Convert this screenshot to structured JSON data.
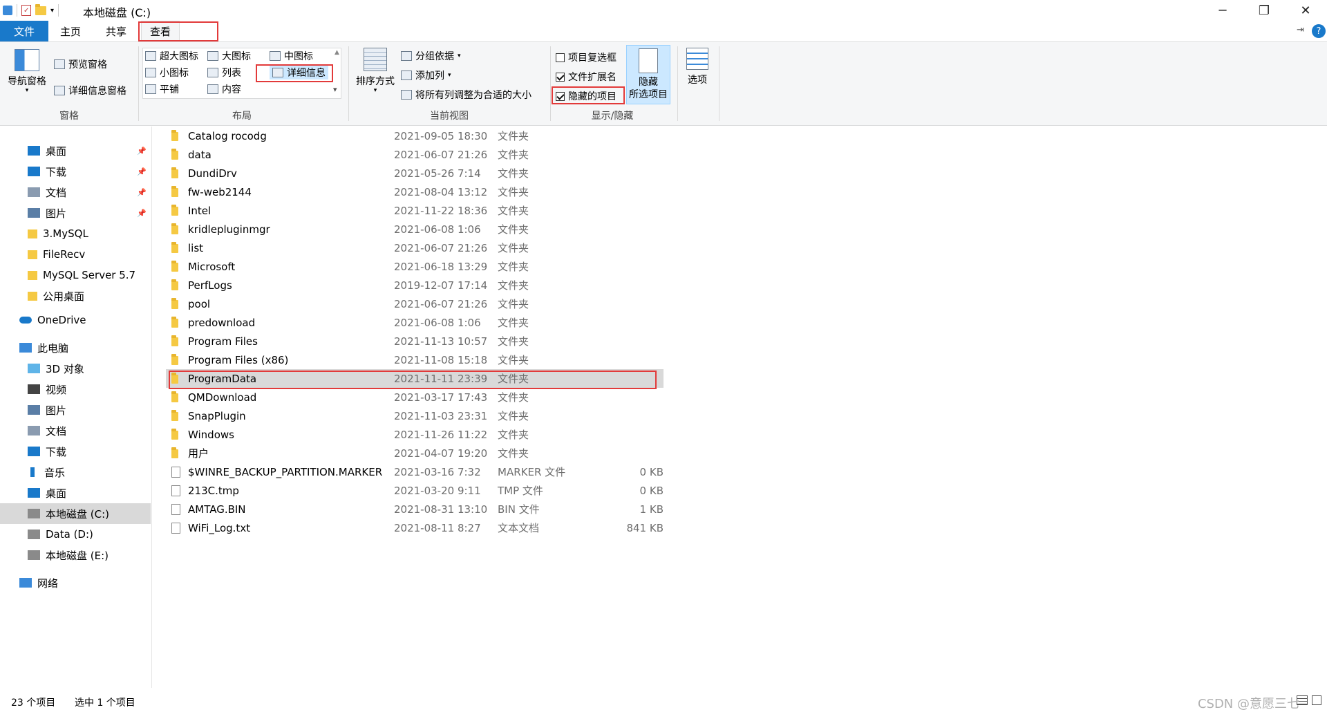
{
  "title": "本地磁盘 (C:)",
  "tabs": {
    "file": "文件",
    "home": "主页",
    "share": "共享",
    "view": "查看"
  },
  "ribbon": {
    "panes": {
      "nav_pane": "导航窗格",
      "preview_pane": "预览窗格",
      "details_pane": "详细信息窗格",
      "label": "窗格"
    },
    "layout": {
      "extra_large": "超大图标",
      "large": "大图标",
      "medium": "中图标",
      "small": "小图标",
      "list": "列表",
      "details": "详细信息",
      "tiles": "平铺",
      "content": "内容",
      "label": "布局"
    },
    "current_view": {
      "sort_by": "排序方式",
      "group_by": "分组依据",
      "add_columns": "添加列",
      "size_all": "将所有列调整为合适的大小",
      "label": "当前视图"
    },
    "show_hide": {
      "item_checkboxes": "项目复选框",
      "file_extensions": "文件扩展名",
      "hidden_items": "隐藏的项目",
      "hide_selected_line1": "隐藏",
      "hide_selected_line2": "所选项目",
      "label": "显示/隐藏",
      "item_checkboxes_checked": false,
      "file_extensions_checked": true,
      "hidden_items_checked": true
    },
    "options": "选项"
  },
  "nav": [
    {
      "label": "桌面",
      "pinned": true,
      "icon": "desktop-icon"
    },
    {
      "label": "下载",
      "pinned": true,
      "icon": "download-icon"
    },
    {
      "label": "文档",
      "pinned": true,
      "icon": "document-icon"
    },
    {
      "label": "图片",
      "pinned": true,
      "icon": "picture-icon"
    },
    {
      "label": "3.MySQL",
      "pinned": false,
      "icon": "folder-icon"
    },
    {
      "label": "FileRecv",
      "pinned": false,
      "icon": "folder-icon"
    },
    {
      "label": "MySQL Server 5.7",
      "pinned": false,
      "icon": "folder-icon"
    },
    {
      "label": "公用桌面",
      "pinned": false,
      "icon": "folder-icon"
    },
    {
      "label": "OneDrive",
      "pinned": false,
      "icon": "cloud-icon"
    },
    {
      "label": "此电脑",
      "pinned": false,
      "icon": "computer-icon"
    },
    {
      "label": "3D 对象",
      "pinned": false,
      "icon": "cube-icon"
    },
    {
      "label": "视频",
      "pinned": false,
      "icon": "video-icon"
    },
    {
      "label": "图片",
      "pinned": false,
      "icon": "picture-icon"
    },
    {
      "label": "文档",
      "pinned": false,
      "icon": "document-icon"
    },
    {
      "label": "下载",
      "pinned": false,
      "icon": "download-icon"
    },
    {
      "label": "音乐",
      "pinned": false,
      "icon": "music-icon"
    },
    {
      "label": "桌面",
      "pinned": false,
      "icon": "desktop-icon"
    },
    {
      "label": "本地磁盘 (C:)",
      "pinned": false,
      "icon": "drive-icon",
      "selected": true
    },
    {
      "label": "Data (D:)",
      "pinned": false,
      "icon": "drive-icon"
    },
    {
      "label": "本地磁盘 (E:)",
      "pinned": false,
      "icon": "drive-icon"
    },
    {
      "label": "网络",
      "pinned": false,
      "icon": "network-icon"
    }
  ],
  "files": [
    {
      "name": "Catalog rocodg",
      "date": "2021-09-05 18:30",
      "type": "文件夹",
      "size": "",
      "kind": "folder"
    },
    {
      "name": "data",
      "date": "2021-06-07 21:26",
      "type": "文件夹",
      "size": "",
      "kind": "folder"
    },
    {
      "name": "DundiDrv",
      "date": "2021-05-26 7:14",
      "type": "文件夹",
      "size": "",
      "kind": "folder"
    },
    {
      "name": "fw-web2144",
      "date": "2021-08-04 13:12",
      "type": "文件夹",
      "size": "",
      "kind": "folder"
    },
    {
      "name": "Intel",
      "date": "2021-11-22 18:36",
      "type": "文件夹",
      "size": "",
      "kind": "folder"
    },
    {
      "name": "kridlepluginmgr",
      "date": "2021-06-08 1:06",
      "type": "文件夹",
      "size": "",
      "kind": "folder"
    },
    {
      "name": "list",
      "date": "2021-06-07 21:26",
      "type": "文件夹",
      "size": "",
      "kind": "folder"
    },
    {
      "name": "Microsoft",
      "date": "2021-06-18 13:29",
      "type": "文件夹",
      "size": "",
      "kind": "folder"
    },
    {
      "name": "PerfLogs",
      "date": "2019-12-07 17:14",
      "type": "文件夹",
      "size": "",
      "kind": "folder"
    },
    {
      "name": "pool",
      "date": "2021-06-07 21:26",
      "type": "文件夹",
      "size": "",
      "kind": "folder"
    },
    {
      "name": "predownload",
      "date": "2021-06-08 1:06",
      "type": "文件夹",
      "size": "",
      "kind": "folder"
    },
    {
      "name": "Program Files",
      "date": "2021-11-13 10:57",
      "type": "文件夹",
      "size": "",
      "kind": "folder"
    },
    {
      "name": "Program Files (x86)",
      "date": "2021-11-08 15:18",
      "type": "文件夹",
      "size": "",
      "kind": "folder"
    },
    {
      "name": "ProgramData",
      "date": "2021-11-11 23:39",
      "type": "文件夹",
      "size": "",
      "kind": "folder",
      "selected": true
    },
    {
      "name": "QMDownload",
      "date": "2021-03-17 17:43",
      "type": "文件夹",
      "size": "",
      "kind": "folder"
    },
    {
      "name": "SnapPlugin",
      "date": "2021-11-03 23:31",
      "type": "文件夹",
      "size": "",
      "kind": "folder"
    },
    {
      "name": "Windows",
      "date": "2021-11-26 11:22",
      "type": "文件夹",
      "size": "",
      "kind": "folder"
    },
    {
      "name": "用户",
      "date": "2021-04-07 19:20",
      "type": "文件夹",
      "size": "",
      "kind": "folder"
    },
    {
      "name": "$WINRE_BACKUP_PARTITION.MARKER",
      "date": "2021-03-16 7:32",
      "type": "MARKER 文件",
      "size": "0 KB",
      "kind": "file"
    },
    {
      "name": "213C.tmp",
      "date": "2021-03-20 9:11",
      "type": "TMP 文件",
      "size": "0 KB",
      "kind": "file"
    },
    {
      "name": "AMTAG.BIN",
      "date": "2021-08-31 13:10",
      "type": "BIN 文件",
      "size": "1 KB",
      "kind": "file"
    },
    {
      "name": "WiFi_Log.txt",
      "date": "2021-08-11 8:27",
      "type": "文本文档",
      "size": "841 KB",
      "kind": "file"
    }
  ],
  "status": {
    "count": "23 个项目",
    "selected": "选中 1 个项目"
  },
  "watermark": "CSDN @意愿三七",
  "colors": {
    "accent": "#1979ca",
    "highlight": "#e23a3a",
    "selected": "#d9d9d9"
  }
}
